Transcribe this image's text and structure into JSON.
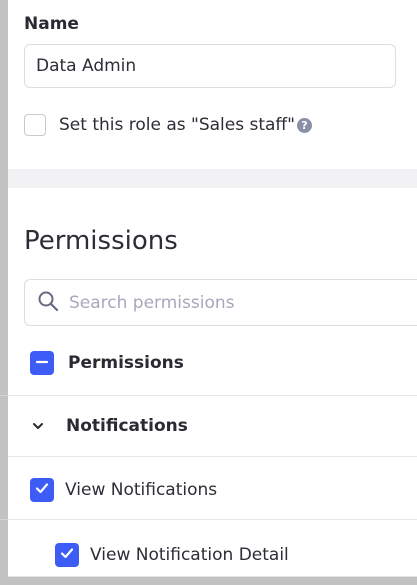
{
  "name_field": {
    "label": "Name",
    "value": "Data Admin"
  },
  "sales_staff": {
    "label": "Set this role as \"Sales staff\"",
    "checked": false,
    "help_icon": "question-circle-icon"
  },
  "permissions": {
    "heading": "Permissions",
    "search_placeholder": "Search  permissions",
    "tree": {
      "root_label": "Permissions",
      "root_state": "indeterminate",
      "group_label": "Notifications",
      "group_expanded": true,
      "items": [
        {
          "label": "View Notifications",
          "checked": true
        },
        {
          "label": "View Notification Detail",
          "checked": true
        }
      ]
    }
  },
  "colors": {
    "accent": "#3d5cf5",
    "border": "#dcdce2",
    "placeholder": "#a7a9bb"
  }
}
